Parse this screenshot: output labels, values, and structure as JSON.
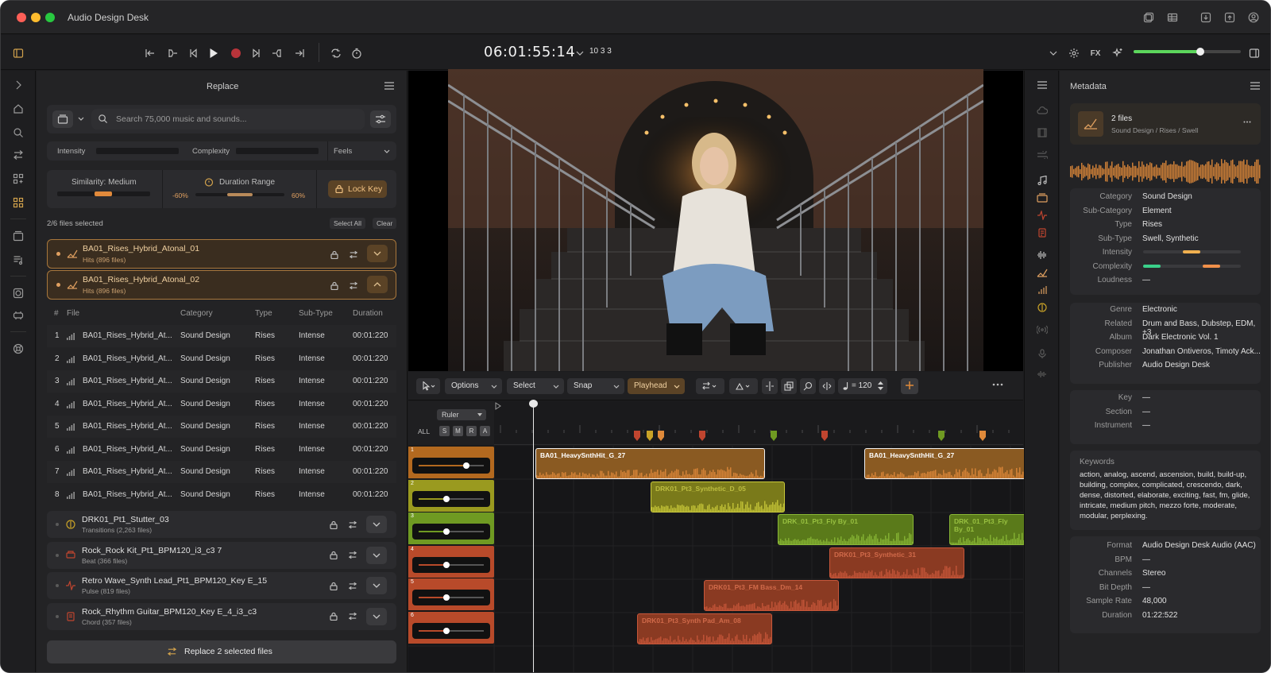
{
  "app": {
    "title": "Audio Design Desk"
  },
  "transport": {
    "timecode": "06:01:55:14",
    "meter": "10 3 3",
    "fx_label": "FX",
    "volume_level": 0.62
  },
  "left": {
    "title": "Replace",
    "search_placeholder": "Search 75,000 music and sounds...",
    "filters": {
      "intensity": "Intensity",
      "complexity": "Complexity",
      "feels": "Feels"
    },
    "similarity": "Similarity: Medium",
    "duration_range": "Duration Range",
    "range_min": "-60%",
    "range_max": "60%",
    "lock_key": "Lock Key",
    "selection_status": "2/6 files selected",
    "select_all": "Select All",
    "clear": "Clear",
    "selected_groups": [
      {
        "name": "BA01_Rises_Hybrid_Atonal_01",
        "sub": "Hits (896 files)"
      },
      {
        "name": "BA01_Rises_Hybrid_Atonal_02",
        "sub": "Hits (896 files)"
      }
    ],
    "table": {
      "headers": [
        "#",
        "File",
        "Category",
        "Type",
        "Sub-Type",
        "Duration"
      ],
      "rows": [
        {
          "n": "1",
          "file": "BA01_Rises_Hybrid_At...",
          "category": "Sound Design",
          "type": "Rises",
          "subtype": "Intense",
          "duration": "00:01:220"
        },
        {
          "n": "2",
          "file": "BA01_Rises_Hybrid_At...",
          "category": "Sound Design",
          "type": "Rises",
          "subtype": "Intense",
          "duration": "00:01:220"
        },
        {
          "n": "3",
          "file": "BA01_Rises_Hybrid_At...",
          "category": "Sound Design",
          "type": "Rises",
          "subtype": "Intense",
          "duration": "00:01:220"
        },
        {
          "n": "4",
          "file": "BA01_Rises_Hybrid_At...",
          "category": "Sound Design",
          "type": "Rises",
          "subtype": "Intense",
          "duration": "00:01:220"
        },
        {
          "n": "5",
          "file": "BA01_Rises_Hybrid_At...",
          "category": "Sound Design",
          "type": "Rises",
          "subtype": "Intense",
          "duration": "00:01:220"
        },
        {
          "n": "6",
          "file": "BA01_Rises_Hybrid_At...",
          "category": "Sound Design",
          "type": "Rises",
          "subtype": "Intense",
          "duration": "00:01:220"
        },
        {
          "n": "7",
          "file": "BA01_Rises_Hybrid_At...",
          "category": "Sound Design",
          "type": "Rises",
          "subtype": "Intense",
          "duration": "00:01:220"
        },
        {
          "n": "8",
          "file": "BA01_Rises_Hybrid_At...",
          "category": "Sound Design",
          "type": "Rises",
          "subtype": "Intense",
          "duration": "00:01:220"
        }
      ]
    },
    "groups": [
      {
        "name": "DRK01_Pt1_Stutter_03",
        "sub": "Transitions (2,263 files)",
        "color": "#c9a227"
      },
      {
        "name": "Rock_Rock Kit_Pt1_BPM120_i3_c3 7",
        "sub": "Beat (366 files)",
        "color": "#c0452f"
      },
      {
        "name": "Retro Wave_Synth Lead_Pt1_BPM120_Key E_15",
        "sub": "Pulse (819 files)",
        "color": "#c0452f"
      },
      {
        "name": "Rock_Rhythm Guitar_BPM120_Key E_4_i3_c3",
        "sub": "Chord (357 files)",
        "color": "#c0452f"
      }
    ],
    "replace_button": "Replace 2 selected files"
  },
  "timeline": {
    "options": "Options",
    "select": "Select",
    "snap": "Snap",
    "playhead": "Playhead",
    "tempo": "= 120",
    "ruler": "Ruler",
    "all": "ALL",
    "flags": [
      "S",
      "M",
      "R",
      "A"
    ],
    "tracks": [
      {
        "num": "1",
        "color": "#b3691f",
        "fader": 0.72
      },
      {
        "num": "2",
        "color": "#9a9a1f",
        "fader": 0.42
      },
      {
        "num": "3",
        "color": "#6f9a22",
        "fader": 0.42
      },
      {
        "num": "4",
        "color": "#b84a2a",
        "fader": 0.42
      },
      {
        "num": "5",
        "color": "#b84a2a",
        "fader": 0.42
      },
      {
        "num": "6",
        "color": "#b84a2a",
        "fader": 0.42
      }
    ],
    "clips": [
      {
        "name": "BA01_HeavySnthHit_G_27",
        "track": 0
      },
      {
        "name": "BA01_HeavySnthHit_G_27",
        "track": 0
      },
      {
        "name": "DRK01_Pt3_Synthetic_D_05",
        "track": 1
      },
      {
        "name": "DRK_01_Pt3_Fly By_01",
        "track": 2
      },
      {
        "name": "DRK_01_Pt3_Fly By_01",
        "track": 2
      },
      {
        "name": "DRK01_Pt3_Synthetic_31",
        "track": 3
      },
      {
        "name": "DRK01_Pt3_FM Bass_Dm_14",
        "track": 4
      },
      {
        "name": "DRK01_Pt3_Synth Pad_Am_08",
        "track": 5
      }
    ]
  },
  "metadata": {
    "title": "Metadata",
    "summary": {
      "files": "2 files",
      "path": [
        "Sound Design",
        "Rises",
        "Swell"
      ],
      "sep": "/"
    },
    "block1": [
      [
        "Category",
        "Sound Design"
      ],
      [
        "Sub-Category",
        "Element"
      ],
      [
        "Type",
        "Rises"
      ],
      [
        "Sub-Type",
        "Swell, Synthetic"
      ],
      [
        "Intensity",
        ""
      ],
      [
        "Complexity",
        ""
      ],
      [
        "Loudness",
        "—"
      ]
    ],
    "block2": [
      [
        "Genre",
        "Electronic"
      ],
      [
        "Related",
        "Drum and Bass, Dubstep, EDM, +3"
      ],
      [
        "Album",
        "Dark Electronic Vol. 1"
      ],
      [
        "Composer",
        "Jonathan Ontiveros, Timoty Ack..."
      ],
      [
        "Publisher",
        "Audio Design Desk"
      ]
    ],
    "block3": [
      [
        "Key",
        "—"
      ],
      [
        "Section",
        "—"
      ],
      [
        "Instrument",
        "—"
      ]
    ],
    "keywords_label": "Keywords",
    "keywords": "action, analog, ascend, ascension, build, build-up, building, complex, complicated, crescendo, dark, dense, distorted, elaborate, exciting, fast, fm, glide, intricate, medium pitch, mezzo forte, moderate, modular, perplexing.",
    "block4": [
      [
        "Format",
        "Audio Design Desk Audio (AAC)"
      ],
      [
        "BPM",
        "—"
      ],
      [
        "Channels",
        "Stereo"
      ],
      [
        "Bit Depth",
        "—"
      ],
      [
        "Sample Rate",
        "48,000"
      ],
      [
        "Duration",
        "01:22:522"
      ]
    ]
  }
}
